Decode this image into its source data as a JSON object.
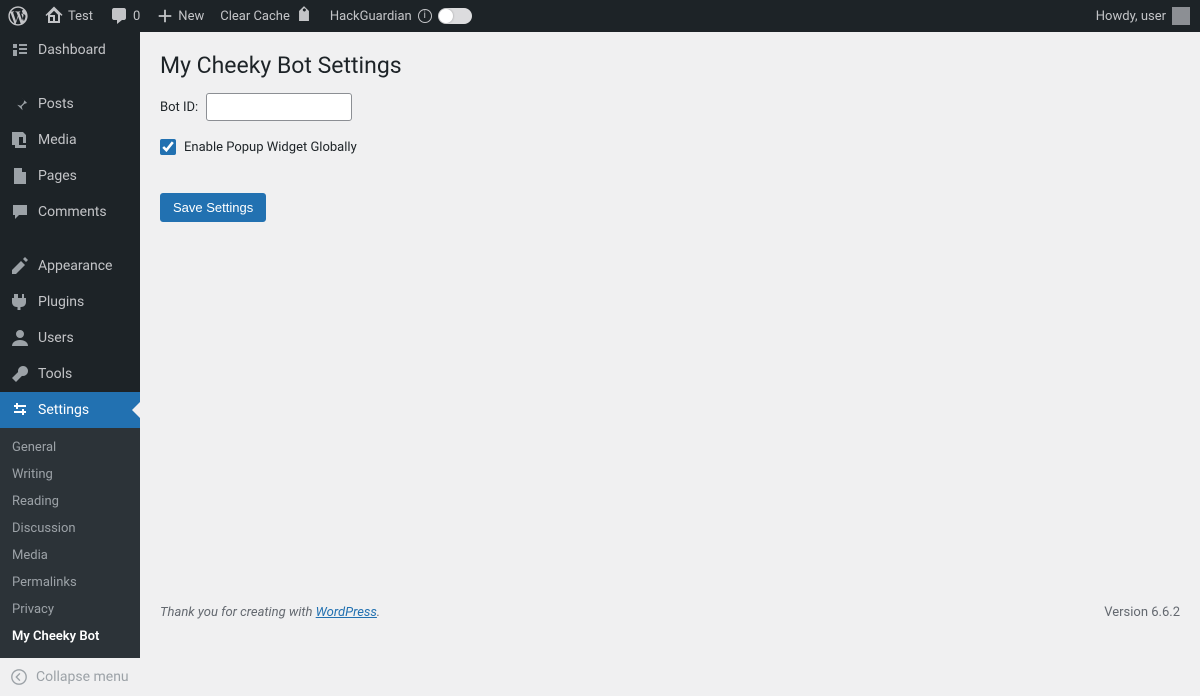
{
  "adminbar": {
    "site_name": "Test",
    "comments_count": "0",
    "new_label": "New",
    "clear_cache": "Clear Cache",
    "hackguardian": "HackGuardian",
    "howdy": "Howdy, user"
  },
  "sidebar": {
    "items": [
      {
        "label": "Dashboard"
      },
      {
        "label": "Posts"
      },
      {
        "label": "Media"
      },
      {
        "label": "Pages"
      },
      {
        "label": "Comments"
      },
      {
        "label": "Appearance"
      },
      {
        "label": "Plugins"
      },
      {
        "label": "Users"
      },
      {
        "label": "Tools"
      },
      {
        "label": "Settings"
      }
    ],
    "submenu": [
      {
        "label": "General"
      },
      {
        "label": "Writing"
      },
      {
        "label": "Reading"
      },
      {
        "label": "Discussion"
      },
      {
        "label": "Media"
      },
      {
        "label": "Permalinks"
      },
      {
        "label": "Privacy"
      },
      {
        "label": "My Cheeky Bot"
      }
    ],
    "collapse": "Collapse menu"
  },
  "page": {
    "title": "My Cheeky Bot Settings",
    "bot_id_label": "Bot ID:",
    "bot_id_value": "",
    "checkbox_label": "Enable Popup Widget Globally",
    "save_button": "Save Settings"
  },
  "footer": {
    "thank_prefix": "Thank you for creating with ",
    "wp_link": "WordPress",
    "thank_suffix": ".",
    "version": "Version 6.6.2"
  }
}
